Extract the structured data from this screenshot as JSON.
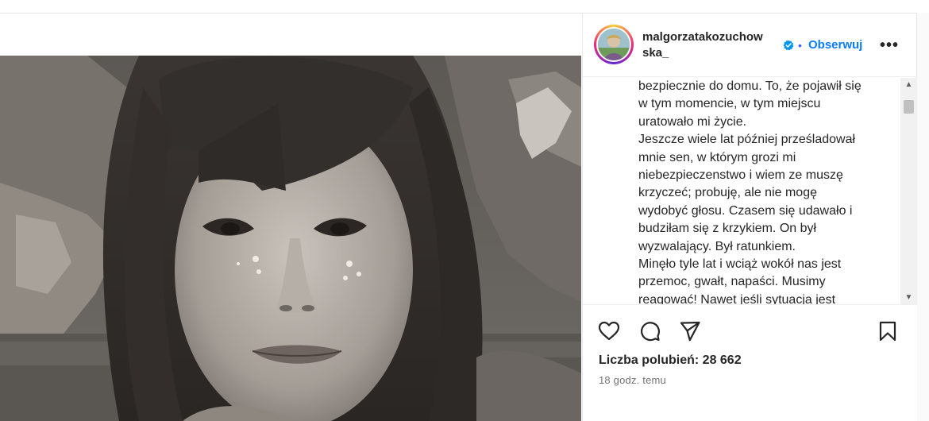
{
  "post": {
    "username": "malgorzatakozuchowska_",
    "username_line1": "malgorzatakozuchow",
    "username_line2": "ska_",
    "separator": "•",
    "follow_label": "Obserwuj",
    "more_label": "•••",
    "caption_lines": [
      "bezpiecznie do domu. To, że pojawił się",
      "w tym momencie, w tym miejscu",
      "uratowało mi życie.",
      "Jeszcze wiele lat później prześladował",
      "mnie sen, w którym grozi mi",
      "niebezpieczenstwo i wiem ze muszę",
      "krzyczeć; probuję, ale nie mogę",
      "wydobyć głosu. Czasem się udawało i",
      "budziłam się z krzykiem. On był",
      "wyzwalający. Był ratunkiem.",
      "Minęło tyle lat i wciąż wokół nas jest",
      "przemoc, gwałt, napaści. Musimy",
      "reagować! Nawet jeśli sytuacja jest"
    ],
    "likes_text": "Liczba polubień: 28 662",
    "time_text": "18 godz. temu"
  },
  "icons": {
    "like": "heart-icon",
    "comment": "comment-icon",
    "share": "send-icon",
    "save": "bookmark-icon",
    "verified": "verified-badge-icon"
  },
  "colors": {
    "link_blue": "#0a7cff",
    "verified_blue": "#0095f6",
    "text": "#262626",
    "muted": "#737373"
  }
}
